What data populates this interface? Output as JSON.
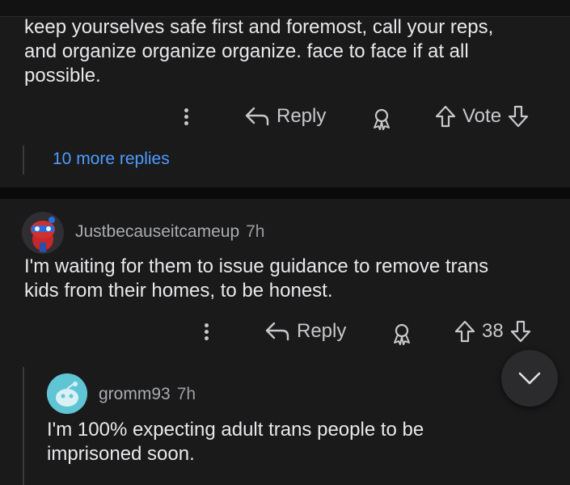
{
  "top_comment": {
    "text_lines": [
      "keep yourselves safe first and foremost, call your reps,",
      "and organize organize organize. face to face if at all",
      "possible."
    ],
    "reply_label": "Reply",
    "vote_label": "Vote",
    "more_replies": "10 more replies"
  },
  "comment": {
    "username": "Justbecauseitcameup",
    "time": "7h",
    "text_lines": [
      "I'm waiting for them to issue guidance to remove trans",
      "kids from their homes, to be honest."
    ],
    "reply_label": "Reply",
    "vote_count": "38"
  },
  "reply": {
    "username": "gromm93",
    "time": "7h",
    "text_lines": [
      "I'm 100% expecting adult trans people to be",
      "imprisoned soon."
    ]
  },
  "icons": {
    "more": "kebab-menu-icon",
    "reply": "reply-arrow-icon",
    "award": "award-icon",
    "upvote": "upvote-arrow-icon",
    "downvote": "downvote-arrow-icon",
    "scroll_down": "chevron-down-icon"
  },
  "colors": {
    "background": "#1a1a1b",
    "link": "#4f9bff",
    "text": "#e8e8ea",
    "muted": "#9a9ca0"
  }
}
